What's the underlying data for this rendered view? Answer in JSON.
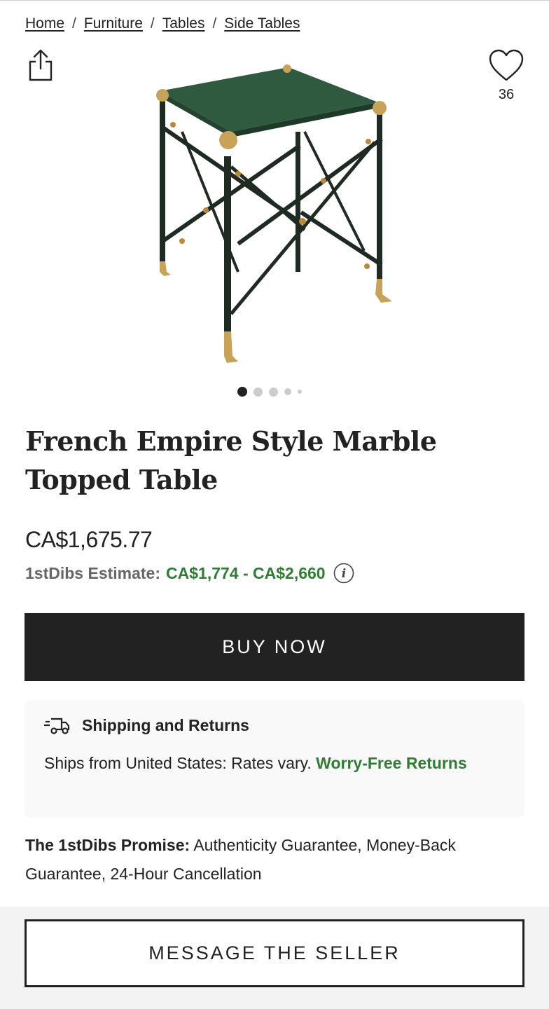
{
  "breadcrumb": {
    "items": [
      "Home",
      "Furniture",
      "Tables",
      "Side Tables"
    ],
    "separator": "/"
  },
  "icons": {
    "share": "share-icon",
    "favorite": "heart-icon",
    "info": "info-icon",
    "shipping": "shipping-truck-icon"
  },
  "favorites": {
    "count": "36"
  },
  "gallery": {
    "dot_count": 5,
    "active_index": 0
  },
  "product": {
    "title": "French Empire Style Marble Topped Table",
    "price": "CA$1,675.77",
    "estimate_label": "1stDibs Estimate:",
    "estimate_value": "CA$1,774 - CA$2,660"
  },
  "actions": {
    "buy_now": "BUY NOW",
    "message_seller": "MESSAGE THE SELLER"
  },
  "shipping": {
    "title": "Shipping and Returns",
    "text": "Ships from United States: Rates vary.",
    "link": "Worry-Free Returns"
  },
  "promise": {
    "label": "The 1stDibs Promise:",
    "text": "Authenticity Guarantee, Money-Back Guarantee, 24-Hour Cancellation"
  },
  "colors": {
    "accent_green": "#2e7d32",
    "dark": "#222222",
    "marble": "#2f5a40",
    "gilt": "#c9a25a"
  }
}
